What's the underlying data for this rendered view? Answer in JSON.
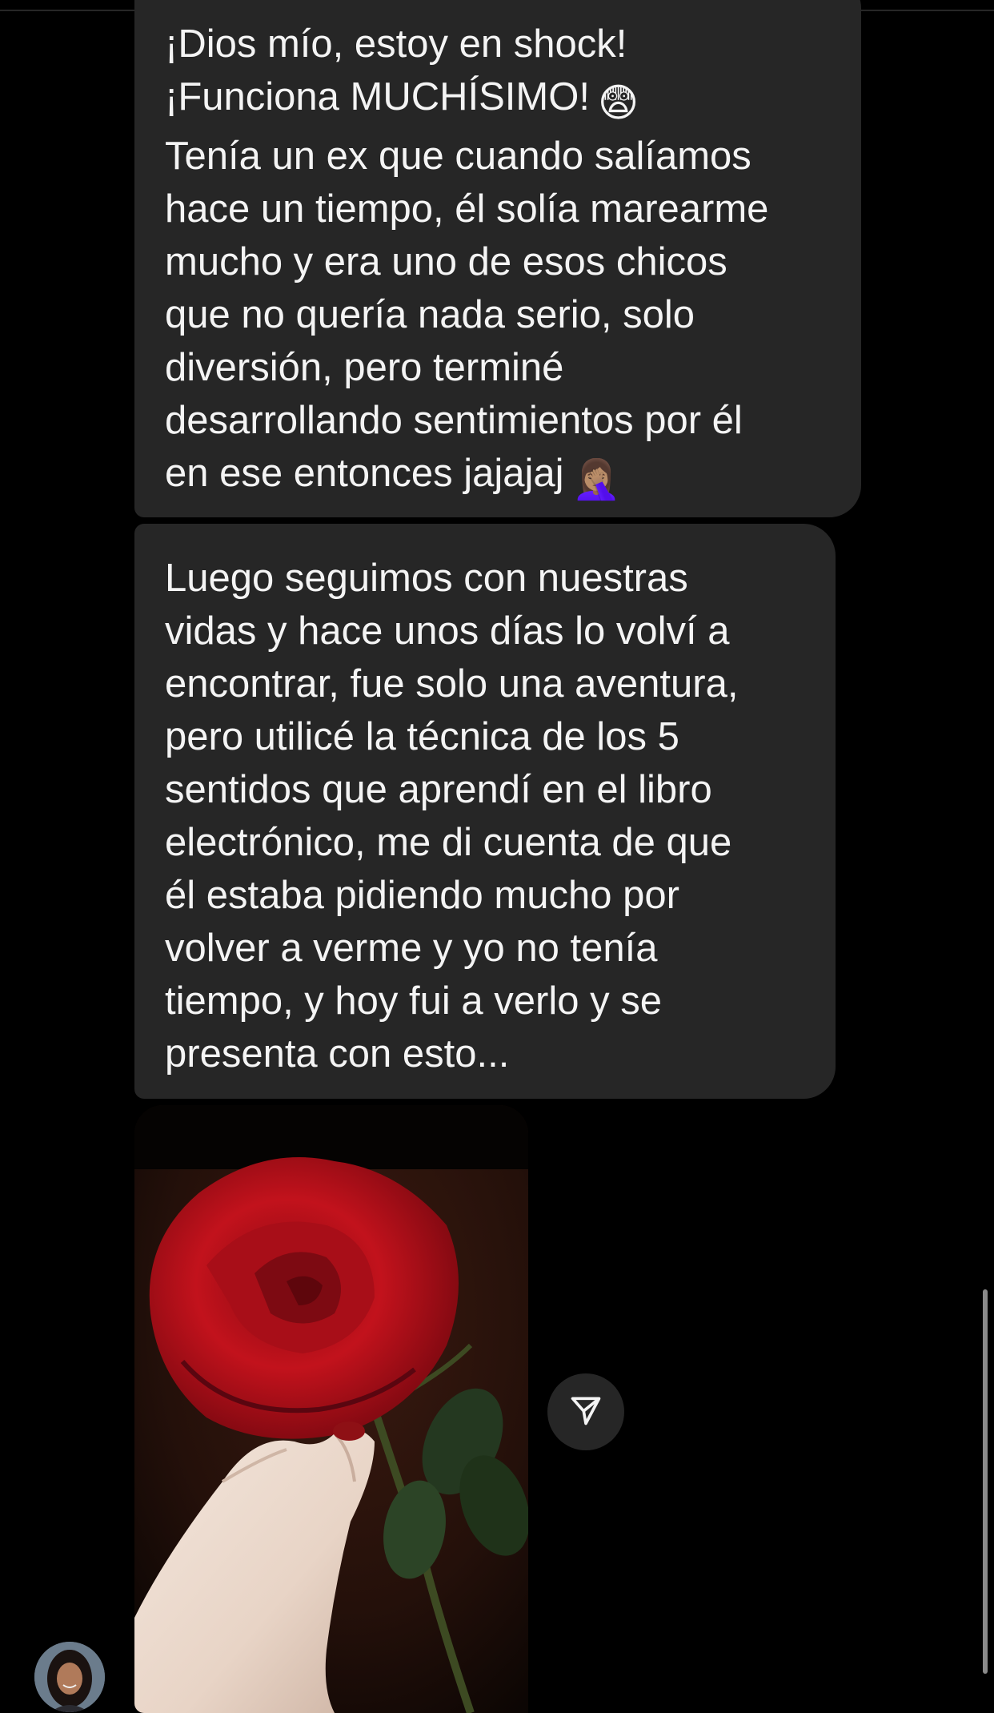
{
  "conversation": {
    "messages": [
      {
        "text": "¡Dios mío, estoy en shock!\n¡Funciona MUCHÍSIMO!",
        "text_continued": "Tenía un ex que cuando salíamos\nhace un tiempo, él solía marearme\nmucho y era uno de esos chicos\nque no quería nada serio, solo\ndiversión, pero terminé\ndesarrollando sentimientos por él\nen ese entonces jajajaj",
        "emoji_1": "😨",
        "emoji_2": "🤦🏽‍♀️"
      },
      {
        "text": "Luego seguimos con nuestras\nvidas y hace unos días lo volví a\nencontrar, fue solo una aventura,\npero utilicé la técnica de los 5\nsentidos que aprendí en el libro\nelectrónico, me di cuenta de que\nél estaba pidiendo mucho por\nvolver a verme y yo no tenía\ntiempo, y hoy fui a verlo y se\npresenta con esto..."
      }
    ],
    "photo": {
      "subject": "red-rose-in-hand"
    },
    "share_icon": "paper-plane-icon"
  },
  "colors": {
    "background": "#000000",
    "bubble": "#262626",
    "text": "#f4f4f4"
  }
}
